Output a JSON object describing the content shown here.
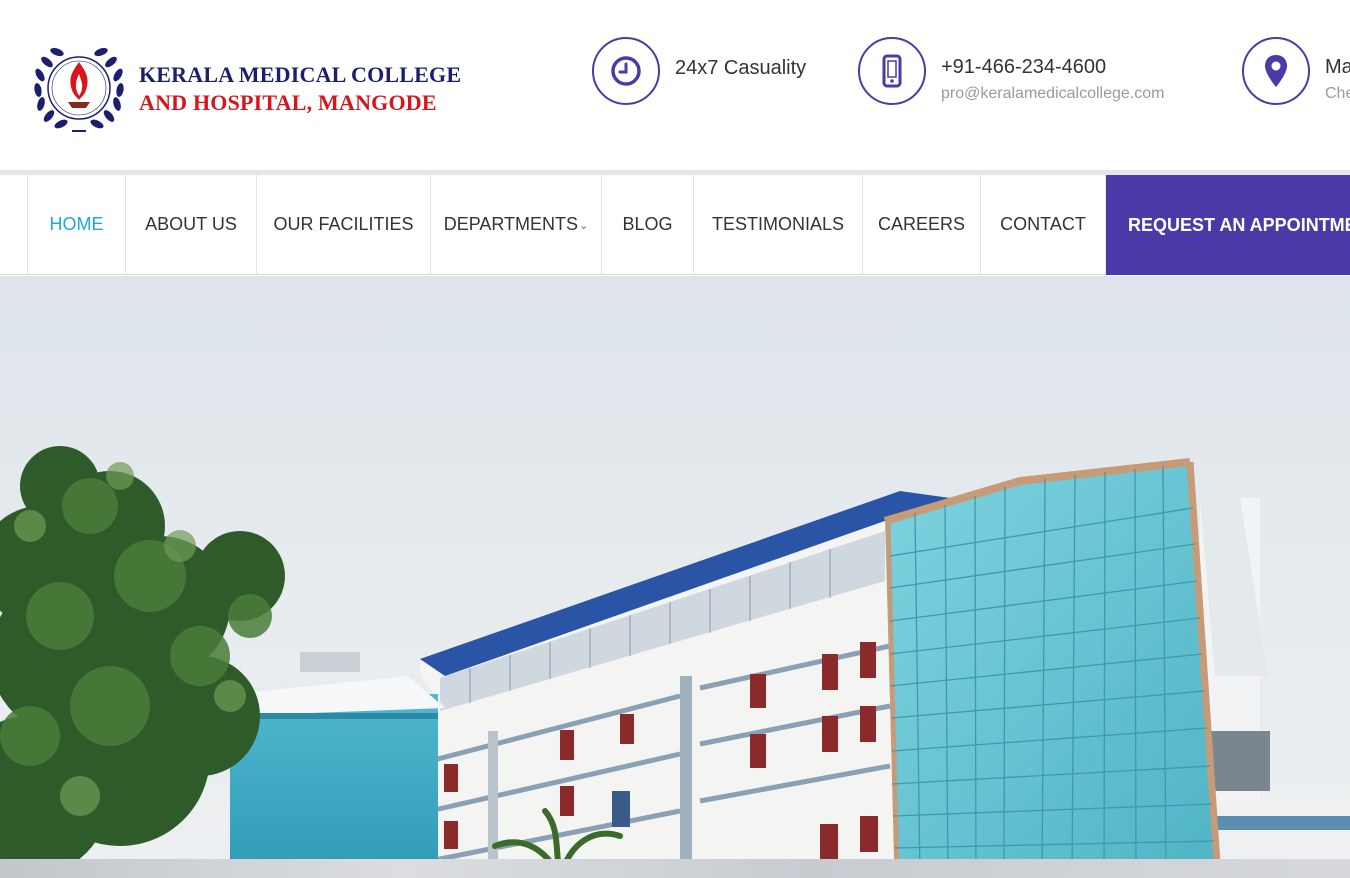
{
  "brand": {
    "line1": "KERALA MEDICAL COLLEGE",
    "line2": "AND HOSPITAL, MANGODE",
    "logo_icon": "flame-wreath-emblem"
  },
  "contact_bar": {
    "casualty": {
      "icon": "clock-icon",
      "title": "24x7 Casuality"
    },
    "phone": {
      "icon": "mobile-phone-icon",
      "title": "+91-466-234-4600",
      "email": "pro@keralamedicalcollege.com"
    },
    "location": {
      "icon": "map-pin-icon",
      "title": "Ma",
      "sub": "Che"
    }
  },
  "nav": {
    "items": [
      {
        "label": "HOME",
        "active": true
      },
      {
        "label": "ABOUT US"
      },
      {
        "label": "OUR FACILITIES"
      },
      {
        "label": "DEPARTMENTS",
        "has_dropdown": true
      },
      {
        "label": "BLOG"
      },
      {
        "label": "TESTIMONIALS"
      },
      {
        "label": "CAREERS"
      },
      {
        "label": "CONTACT"
      }
    ],
    "cta": "REQUEST AN APPOINTMENT"
  },
  "colors": {
    "accent": "#4a3aa7",
    "active_link": "#1ea6df",
    "brand_blue": "#1b1f6e",
    "brand_red": "#d9141b"
  },
  "hero": {
    "image": "hospital-building-photo"
  }
}
